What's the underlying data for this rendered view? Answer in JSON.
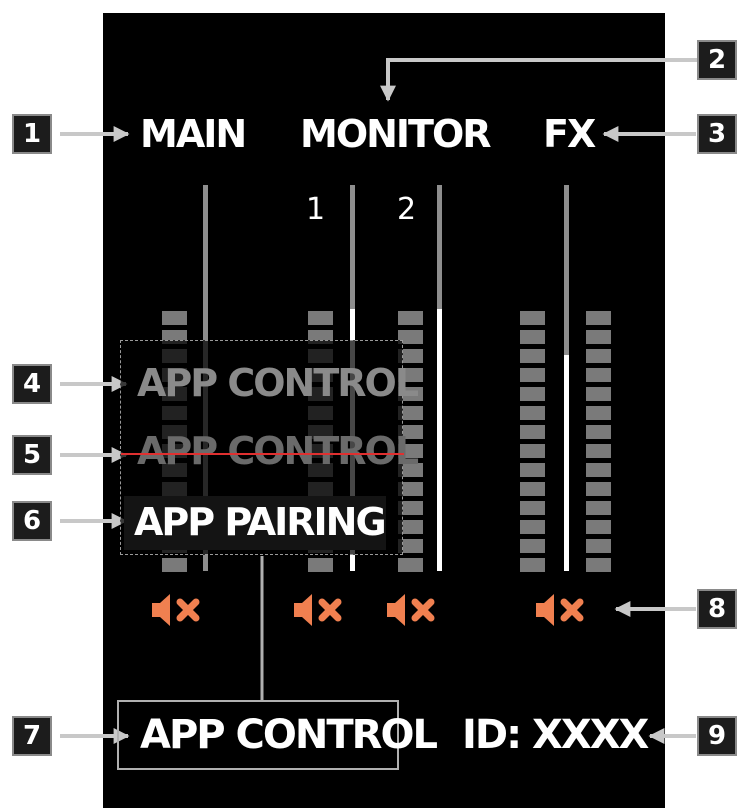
{
  "header": {
    "main_label": "MAIN",
    "monitor_label": "MONITOR",
    "fx_label": "FX",
    "monitor_channel_1": "1",
    "monitor_channel_2": "2"
  },
  "overlay": {
    "app_control_dim": "APP CONTROL",
    "app_control_struck": "APP CONTROL",
    "app_pairing": "APP PAIRING"
  },
  "footer": {
    "app_control": "APP CONTROL",
    "device_id": "ID:  XXXX"
  },
  "callouts": [
    "1",
    "2",
    "3",
    "4",
    "5",
    "6",
    "7",
    "8",
    "9"
  ],
  "faders": {
    "main_level": 0.0,
    "monitor1_level": 0.68,
    "monitor2_level": 0.68,
    "fx_level": 0.56
  },
  "colors": {
    "background": "#000000",
    "text": "#ffffff",
    "dim_text": "#8a8a8a",
    "mute_icon": "#f08050",
    "strike_line": "#e03030",
    "meter_segment": "#7a7a7a"
  },
  "icons": {
    "mute": "speaker-mute-icon"
  }
}
